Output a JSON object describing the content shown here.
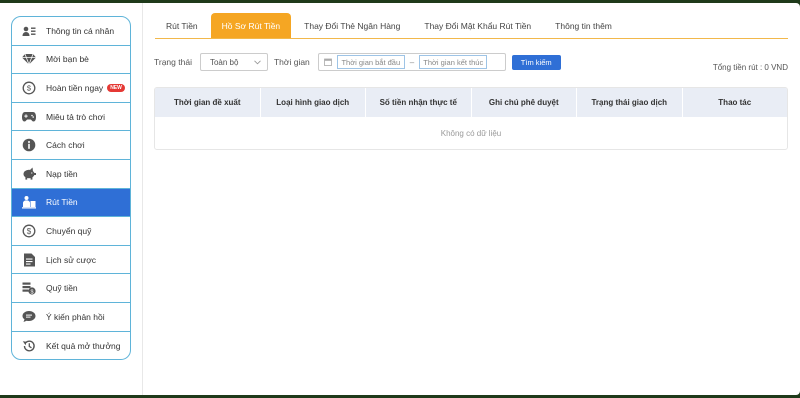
{
  "sidebar": {
    "items": [
      {
        "label": "Thông tin cá nhân",
        "icon": "profile-card-icon"
      },
      {
        "label": "Mời bạn bè",
        "icon": "diamond-icon"
      },
      {
        "label": "Hoàn tiền ngay",
        "icon": "cashback-icon",
        "badge": "NEW"
      },
      {
        "label": "Miêu tả trò chơi",
        "icon": "gamepad-icon"
      },
      {
        "label": "Cách chơi",
        "icon": "info-icon"
      },
      {
        "label": "Nạp tiền",
        "icon": "piggy-bank-icon"
      },
      {
        "label": "Rút Tiền",
        "icon": "withdraw-icon",
        "active": true
      },
      {
        "label": "Chuyển quỹ",
        "icon": "dollar-circle-icon"
      },
      {
        "label": "Lịch sử cược",
        "icon": "document-icon"
      },
      {
        "label": "Quỹ tiền",
        "icon": "coin-stack-icon"
      },
      {
        "label": "Ý kiến phản hồi",
        "icon": "chat-bubble-icon"
      },
      {
        "label": "Kết quả mở thưởng",
        "icon": "history-icon"
      }
    ]
  },
  "tabs": [
    {
      "label": "Rút Tiền"
    },
    {
      "label": "Hồ Sơ Rút Tiền",
      "active": true
    },
    {
      "label": "Thay Đổi Thẻ Ngân Hàng"
    },
    {
      "label": "Thay Đổi Mật Khẩu Rút Tiền"
    },
    {
      "label": "Thông tin thêm"
    }
  ],
  "filters": {
    "status_label": "Trạng thái",
    "status_value": "Toàn bộ",
    "time_label": "Thời gian",
    "start_placeholder": "Thời gian bắt đầu",
    "end_placeholder": "Thời gian kết thúc",
    "separator": "–",
    "search_label": "Tìm kiếm"
  },
  "total": "Tổng tiền rút : 0 VND",
  "table": {
    "headers": [
      "Thời gian đề xuất",
      "Loại hình giao dịch",
      "Số tiền nhận thực tế",
      "Ghi chú phê duyệt",
      "Trạng thái giao dịch",
      "Thao tác"
    ],
    "empty_text": "Không có dữ liệu"
  },
  "colors": {
    "accent": "#2f6fd6",
    "tab_active": "#f5a623",
    "sidebar_border": "#5fb4d9",
    "badge": "#e53935"
  }
}
